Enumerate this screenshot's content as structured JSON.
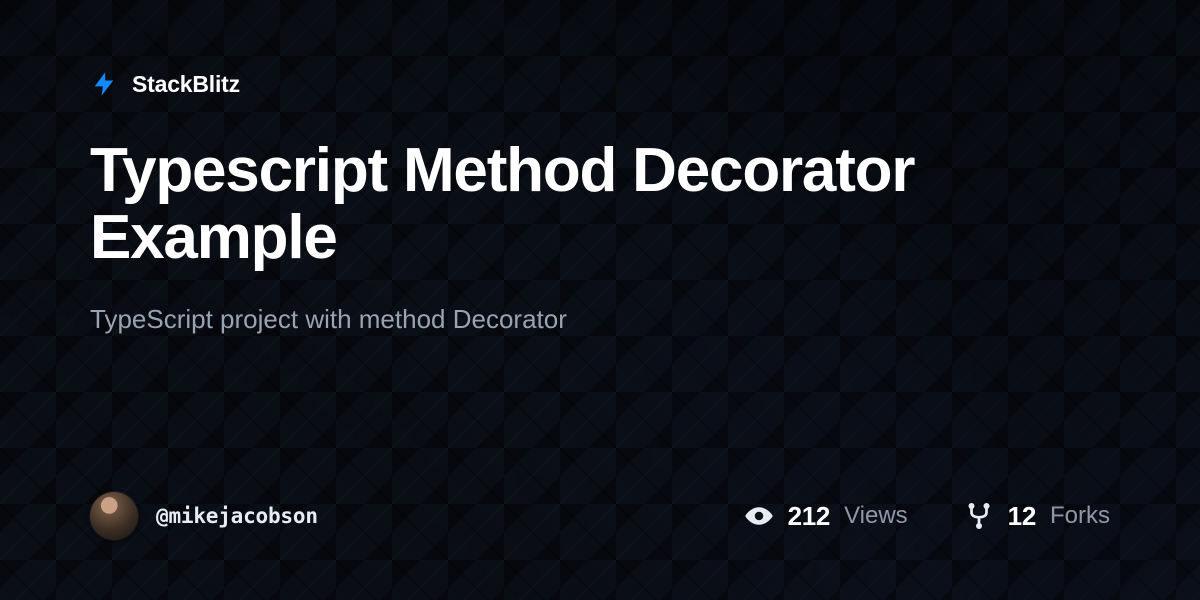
{
  "brand": {
    "name": "StackBlitz",
    "accent": "#1389FD"
  },
  "project": {
    "title": "Typescript Method Decorator Example",
    "subtitle": "TypeScript project with method Decorator"
  },
  "author": {
    "handle": "@mikejacobson"
  },
  "stats": {
    "views": {
      "count": "212",
      "label": "Views"
    },
    "forks": {
      "count": "12",
      "label": "Forks"
    }
  }
}
